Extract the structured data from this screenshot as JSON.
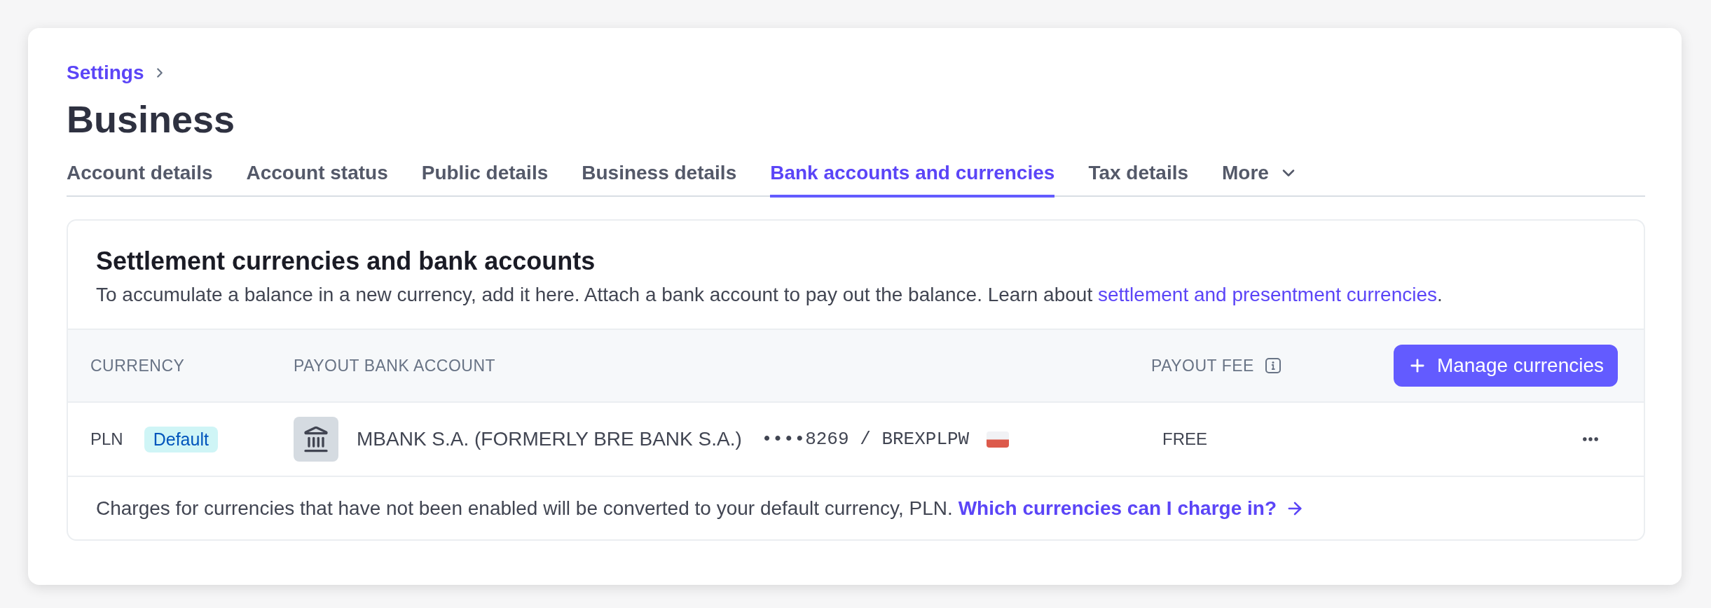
{
  "breadcrumb": {
    "label": "Settings"
  },
  "page_title": "Business",
  "tabs": [
    {
      "label": "Account details",
      "kind": "tab",
      "selected": false
    },
    {
      "label": "Account status",
      "kind": "tab",
      "selected": false
    },
    {
      "label": "Public details",
      "kind": "tab",
      "selected": false
    },
    {
      "label": "Business details",
      "kind": "tab",
      "selected": false
    },
    {
      "label": "Bank accounts and currencies",
      "kind": "tab",
      "selected": true
    },
    {
      "label": "Tax details",
      "kind": "tab",
      "selected": false
    },
    {
      "label": "More",
      "kind": "menu",
      "selected": false
    }
  ],
  "settlement_card": {
    "title": "Settlement currencies and bank accounts",
    "description": {
      "text": "To accumulate a balance in a new currency, add it here. Attach a bank account to pay out the balance. Learn about",
      "link": "settlement and presentment currencies",
      "text_after": "."
    },
    "table": {
      "columns": [
        "CURRENCY",
        "PAYOUT BANK ACCOUNT",
        "PAYOUT FEE"
      ],
      "action_button": "Manage currencies",
      "rows": [
        {
          "currency": "PLN",
          "badge": "Default",
          "bank_name": "MBANK S.A. (FORMERLY BRE BANK S.A.)",
          "account": "••••8269 / BREXPLPW",
          "payout_fee": "FREE"
        }
      ]
    },
    "footer": {
      "text": "Charges for currencies that have not been enabled will be converted to your default currency, PLN.",
      "link": "Which currencies can I charge in?"
    }
  }
}
